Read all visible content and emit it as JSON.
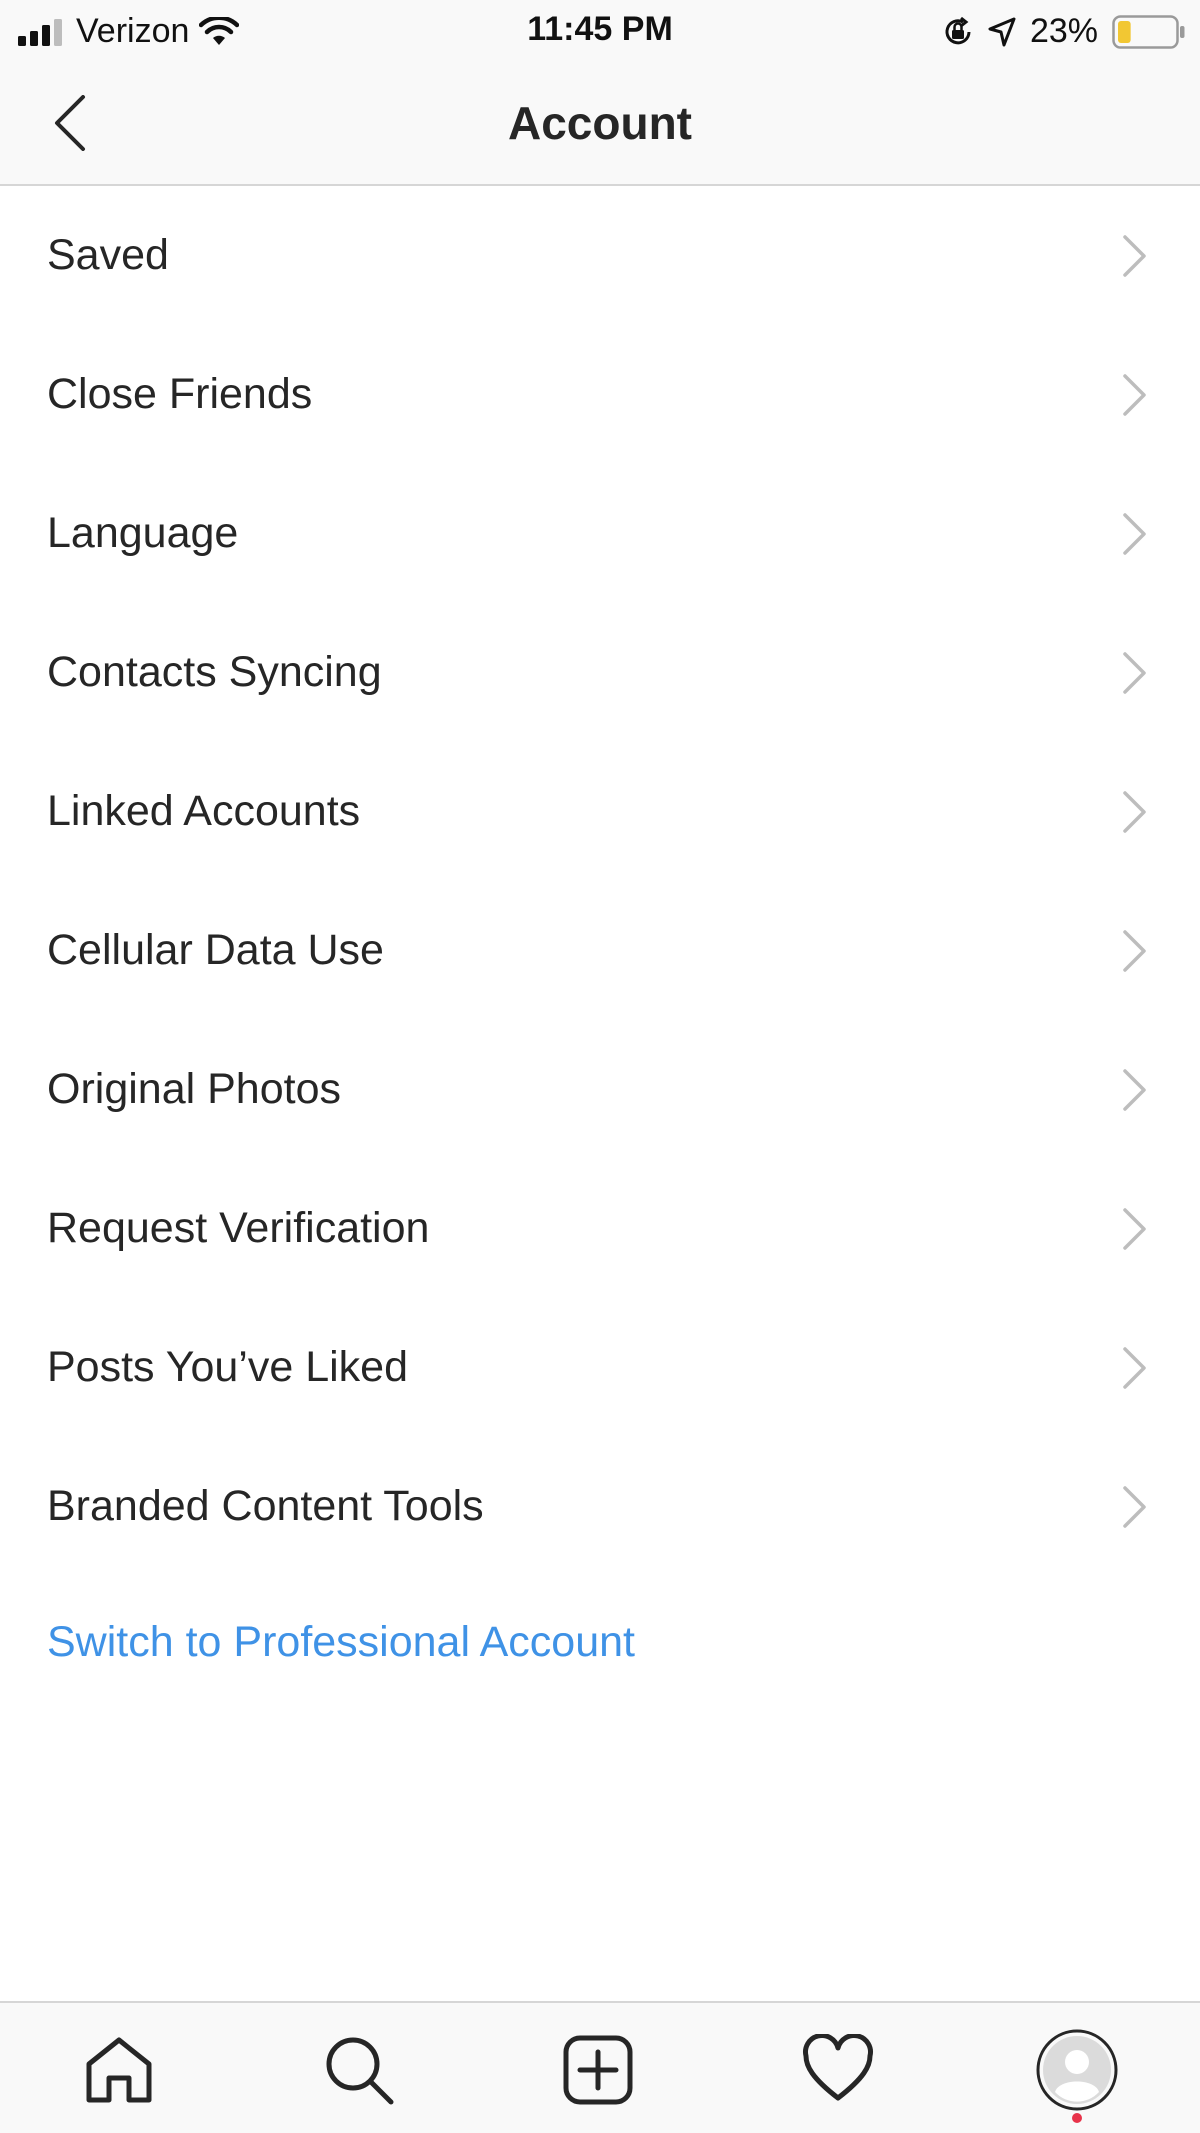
{
  "status_bar": {
    "carrier": "Verizon",
    "time": "11:45 PM",
    "battery_percent": "23%",
    "battery_level": 0.23,
    "battery_color": "#f2c733",
    "icons": [
      "signal-icon",
      "wifi-icon",
      "rotation-lock-icon",
      "location-icon",
      "battery-icon"
    ]
  },
  "header": {
    "title": "Account",
    "back_icon": "chevron-left-icon"
  },
  "menu": {
    "items": [
      {
        "label": "Saved"
      },
      {
        "label": "Close Friends"
      },
      {
        "label": "Language"
      },
      {
        "label": "Contacts Syncing"
      },
      {
        "label": "Linked Accounts"
      },
      {
        "label": "Cellular Data Use"
      },
      {
        "label": "Original Photos"
      },
      {
        "label": "Request Verification"
      },
      {
        "label": "Posts You’ve Liked"
      },
      {
        "label": "Branded Content Tools"
      }
    ],
    "switch_link": "Switch to Professional Account",
    "link_color": "#3f92e6"
  },
  "tab_bar": {
    "tabs": [
      "home-icon",
      "search-icon",
      "add-post-icon",
      "heart-icon",
      "profile-avatar-icon"
    ],
    "notification_color": "#e8334a"
  }
}
